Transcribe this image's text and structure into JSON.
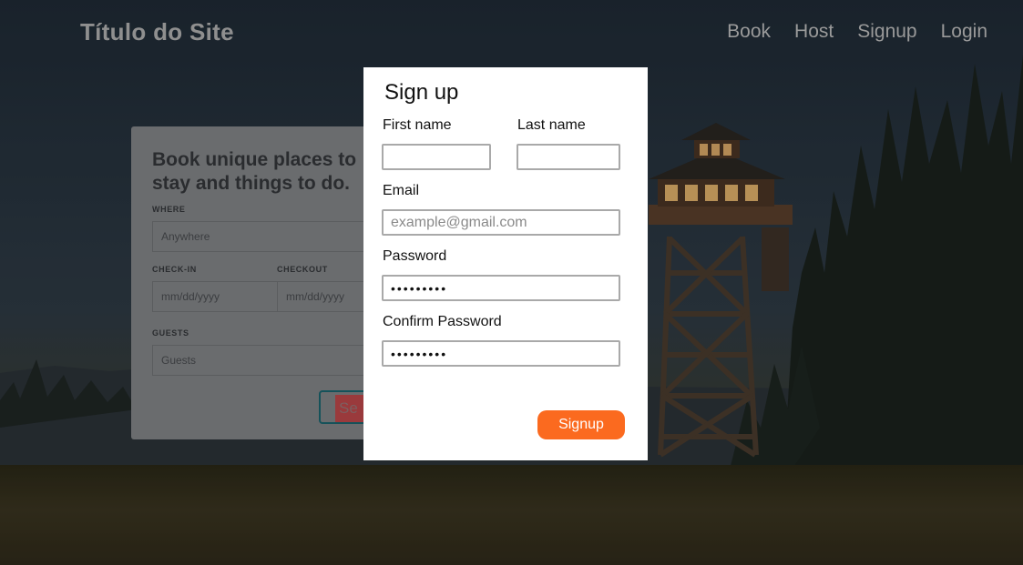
{
  "site": {
    "title": "Título do Site"
  },
  "nav": {
    "items": [
      "Book",
      "Host",
      "Signup",
      "Login"
    ]
  },
  "booking": {
    "heading": "Book unique places to stay and things to do.",
    "where_label": "WHERE",
    "where_placeholder": "Anywhere",
    "checkin_label": "CHECK-IN",
    "checkin_placeholder": "mm/dd/yyyy",
    "checkout_label": "CHECKOUT",
    "checkout_placeholder": "mm/dd/yyyy",
    "guests_label": "GUESTS",
    "guests_placeholder": "Guests",
    "search_label": "Se"
  },
  "signup": {
    "title": "Sign up",
    "first_name_label": "First name",
    "first_name_value": "",
    "last_name_label": "Last name",
    "last_name_value": "",
    "email_label": "Email",
    "email_placeholder": "example@gmail.com",
    "password_label": "Password",
    "password_value": "123456789",
    "confirm_label": "Confirm Password",
    "confirm_value": "123456789",
    "submit_label": "Signup",
    "submit_color": "#fb6a1f"
  }
}
